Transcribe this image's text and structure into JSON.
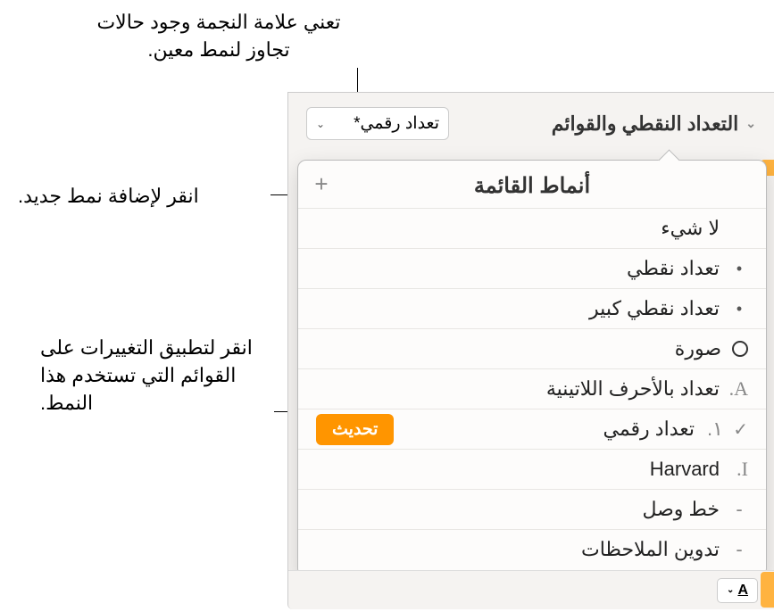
{
  "callouts": {
    "asterisk": "تعني علامة النجمة وجود حالات تجاوز لنمط معين.",
    "add": "انقر لإضافة نمط جديد.",
    "update": "انقر لتطبيق التغييرات على القوائم التي تستخدم هذا النمط."
  },
  "section": {
    "title": "التعداد النقطي والقوائم",
    "dropdown_label": "تعداد رقمي*"
  },
  "popover": {
    "title": "أنماط القائمة",
    "update_button": "تحديث",
    "items": [
      {
        "label": "لا شيء",
        "marker_type": "none",
        "marker": ""
      },
      {
        "label": "تعداد نقطي",
        "marker_type": "bullet",
        "marker": "•"
      },
      {
        "label": "تعداد نقطي كبير",
        "marker_type": "bullet",
        "marker": "•"
      },
      {
        "label": "صورة",
        "marker_type": "image",
        "marker": ""
      },
      {
        "label": "تعداد بالأحرف اللاتينية",
        "marker_type": "letter",
        "marker": "A."
      },
      {
        "label": "تعداد رقمي",
        "marker_type": "number",
        "marker": "١.",
        "selected": true
      },
      {
        "label": "Harvard",
        "marker_type": "roman",
        "marker": "I."
      },
      {
        "label": "خط وصل",
        "marker_type": "dash",
        "marker": "-"
      },
      {
        "label": "تدوين الملاحظات",
        "marker_type": "dash",
        "marker": "-"
      }
    ]
  },
  "toolbar": {
    "font_button": "A"
  }
}
